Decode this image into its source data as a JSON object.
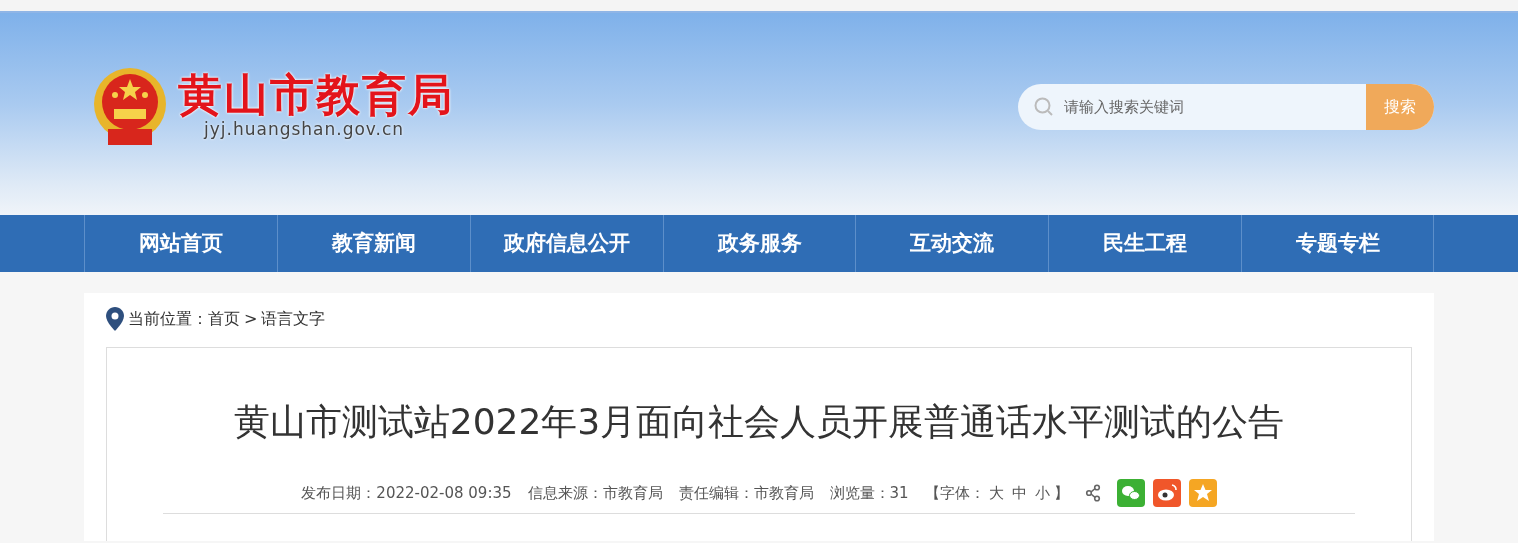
{
  "header": {
    "site_name": "黄山市教育局",
    "domain": "jyj.huangshan.gov.cn",
    "search": {
      "placeholder": "请输入搜索关键词",
      "button": "搜索"
    }
  },
  "nav": [
    {
      "label": "网站首页"
    },
    {
      "label": "教育新闻"
    },
    {
      "label": "政府信息公开"
    },
    {
      "label": "政务服务"
    },
    {
      "label": "互动交流"
    },
    {
      "label": "民生工程"
    },
    {
      "label": "专题专栏"
    }
  ],
  "breadcrumb": {
    "label": "当前位置：",
    "items": [
      "首页",
      "语言文字"
    ],
    "separator": ">"
  },
  "article": {
    "title": "黄山市测试站2022年3月面向社会人员开展普通话水平测试的公告",
    "meta": [
      "发布日期：2022-02-08 09:35",
      "信息来源：市教育局",
      "责任编辑：市教育局",
      "浏览量：31"
    ],
    "font_size": {
      "open": "【字体：",
      "options": [
        "大",
        "中",
        "小"
      ],
      "close": "】"
    },
    "share": [
      {
        "kind": "wechat",
        "color": "#3cb034"
      },
      {
        "kind": "weibo",
        "color": "#f0562a"
      },
      {
        "kind": "favorite",
        "color": "#f5a623"
      }
    ]
  }
}
